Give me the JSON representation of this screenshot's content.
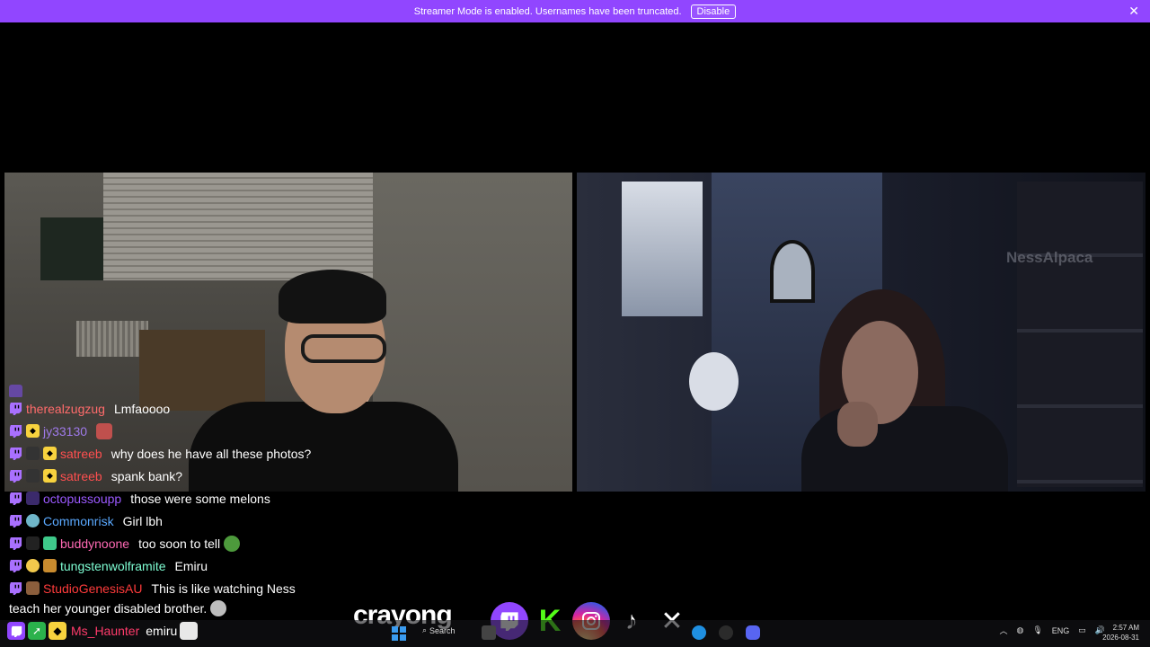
{
  "banner": {
    "message": "Streamer Mode is enabled. Usernames have been truncated.",
    "disable_label": "Disable",
    "close_glyph": "✕",
    "color": "#9146ff"
  },
  "video_right": {
    "overlay_text": "NessAlpaca"
  },
  "chat": {
    "messages": [
      {
        "user": "",
        "color": "#9f7aea",
        "text": ""
      },
      {
        "user": "therealzugzug",
        "color": "#ff6b6b",
        "text": "Lmfaoooo"
      },
      {
        "user": "jy33130",
        "color": "#9f7aea",
        "text": ""
      },
      {
        "user": "satreeb",
        "color": "#ff4f4f",
        "text": "why does he have all these photos?"
      },
      {
        "user": "satreeb",
        "color": "#ff4f4f",
        "text": "spank bank?"
      },
      {
        "user": "octopussoupp",
        "color": "#9b59ff",
        "text": "those were some melons"
      },
      {
        "user": "Commonrisk",
        "color": "#5aa9ff",
        "text": "Girl lbh"
      },
      {
        "user": "buddynoone",
        "color": "#ff69b4",
        "text": "too soon to tell"
      },
      {
        "user": "tungstenwolframite",
        "color": "#7fffd4",
        "text": "Emiru"
      },
      {
        "user": "StudioGenesisAU",
        "color": "#ff3b3b",
        "text": "This is like watching Ness"
      }
    ],
    "continuation_text": "teach her younger disabled brother."
  },
  "taskbar_chat": {
    "user": "Ms_Haunter",
    "text": "emiru"
  },
  "socials": {
    "handle": "crayong",
    "icons": [
      "twitch-icon",
      "kick-icon",
      "instagram-icon",
      "tiktok-icon",
      "x-icon"
    ]
  },
  "taskbar": {
    "search_label": "Search",
    "language": "ENG",
    "time": "2:57 AM",
    "date": "2026-08-31"
  }
}
